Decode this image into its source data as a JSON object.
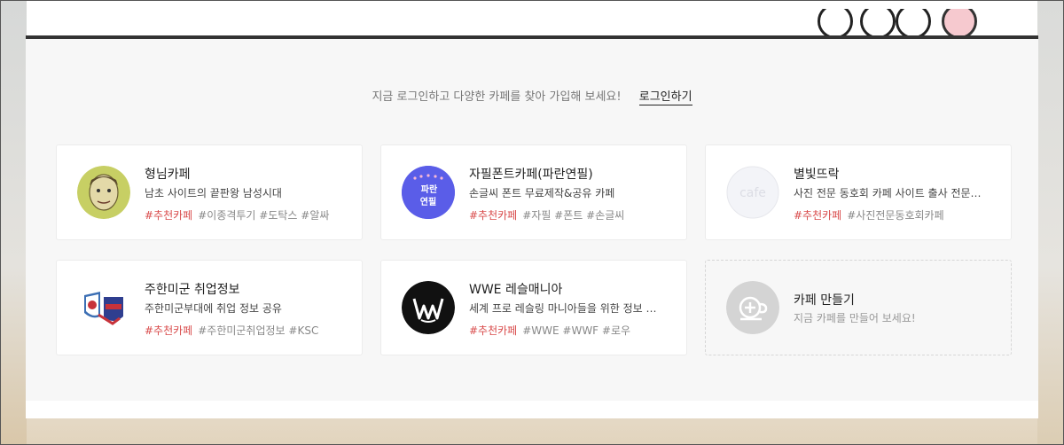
{
  "login_bar": {
    "prompt": "지금 로그인하고 다양한 카페를 찾아 가입해 보세요!",
    "link_label": "로그인하기"
  },
  "cafes": [
    {
      "name": "형님카페",
      "description": "남초 사이트의 끝판왕 남성시대",
      "highlight_tag": "#추천카페",
      "tags": "#이종격투기 #도탁스 #알싸",
      "icon": "caricature-avatar-icon"
    },
    {
      "name": "자필폰트카페(파란연필)",
      "description": "손글씨 폰트 무료제작&공유 카페",
      "highlight_tag": "#추천카페",
      "tags": "#자필 #폰트 #손글씨",
      "logo_text_1": "파란",
      "logo_text_2": "연필",
      "icon": "blue-pencil-logo-icon"
    },
    {
      "name": "별빛뜨락",
      "description": "사진 전문 동호회 카페 사이트 출사 전문…",
      "highlight_tag": "#추천카페",
      "tags": "#사진전문동호회카페",
      "placeholder_text": "cafe",
      "icon": "default-cafe-icon"
    },
    {
      "name": "주한미군 취업정보",
      "description": "주한미군부대에 취업 정보 공유",
      "highlight_tag": "#추천카페",
      "tags": "#주한미군취업정보 #KSC",
      "icon": "shield-emblem-icon"
    },
    {
      "name": "WWE 레슬매니아",
      "description": "세계 프로 레슬링 마니아들을 위한 정보 …",
      "highlight_tag": "#추천카페",
      "tags": "#WWE #WWF #로우",
      "icon": "wwe-logo-icon"
    }
  ],
  "create_card": {
    "title": "카페 만들기",
    "subtitle": "지금 카페를 만들어 보세요!",
    "icon": "add-cup-icon"
  },
  "colors": {
    "highlight_tag": "#d94c4c",
    "panel_bg": "#f7f7f7",
    "pencil_logo_bg": "#5a5de8"
  }
}
